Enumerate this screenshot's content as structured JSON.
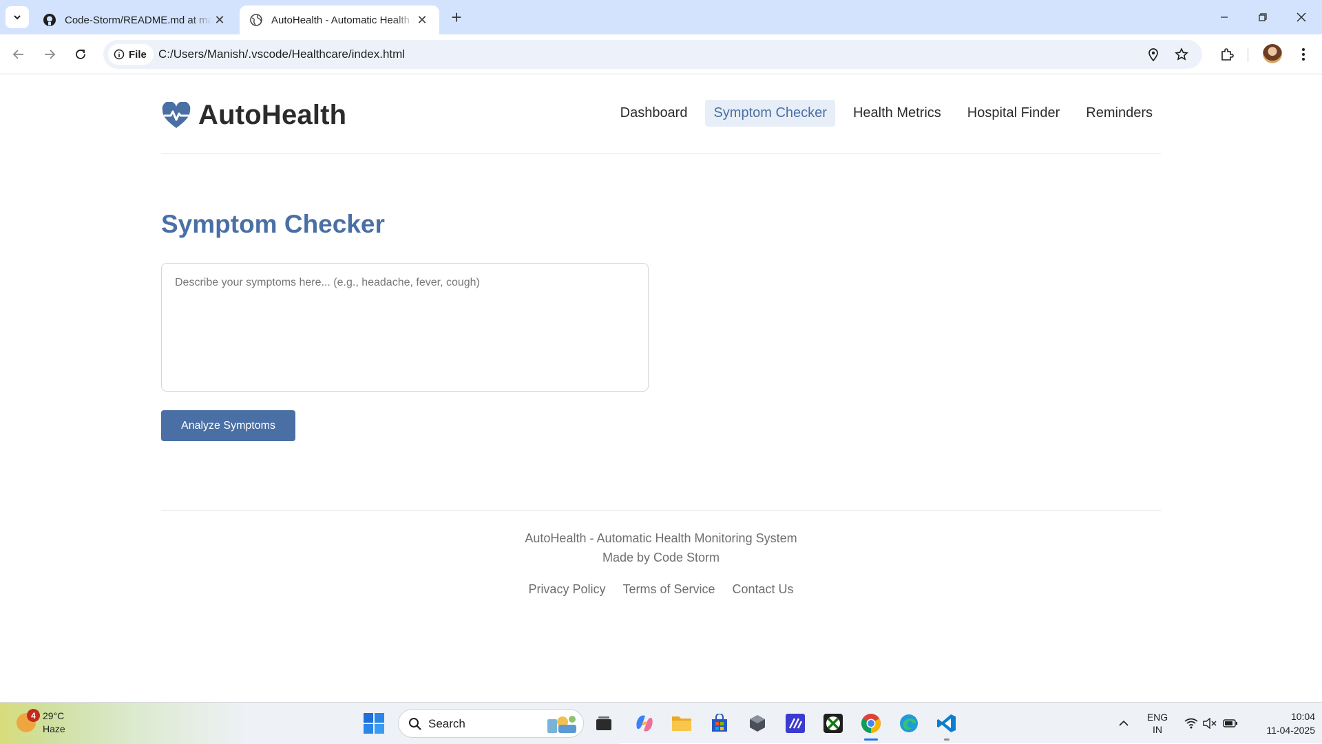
{
  "browser": {
    "tabs": [
      {
        "title": "Code-Storm/README.md at main",
        "icon": "github-icon",
        "active": false
      },
      {
        "title": "AutoHealth - Automatic Health Monitoring System",
        "icon": "globe-icon",
        "active": true
      }
    ],
    "site_chip_label": "File",
    "url": "C:/Users/Manish/.vscode/Healthcare/index.html"
  },
  "site": {
    "logo_text": "AutoHealth",
    "nav": [
      {
        "label": "Dashboard",
        "active": false
      },
      {
        "label": "Symptom Checker",
        "active": true
      },
      {
        "label": "Health Metrics",
        "active": false
      },
      {
        "label": "Hospital Finder",
        "active": false
      },
      {
        "label": "Reminders",
        "active": false
      }
    ],
    "accent_color": "#4a6fa5"
  },
  "symptom_checker": {
    "title": "Symptom Checker",
    "input_value": "",
    "placeholder": "Describe your symptoms here... (e.g., headache, fever, cough)",
    "button_label": "Analyze Symptoms"
  },
  "footer": {
    "line1": "AutoHealth - Automatic Health Monitoring System",
    "line2": "Made by Code Storm",
    "links": [
      "Privacy Policy",
      "Terms of Service",
      "Contact Us"
    ]
  },
  "taskbar": {
    "weather_temp": "29°C",
    "weather_desc": "Haze",
    "weather_badge": "4",
    "search_label": "Search",
    "lang_top": "ENG",
    "lang_bottom": "IN",
    "time": "10:04",
    "date": "11-04-2025"
  }
}
